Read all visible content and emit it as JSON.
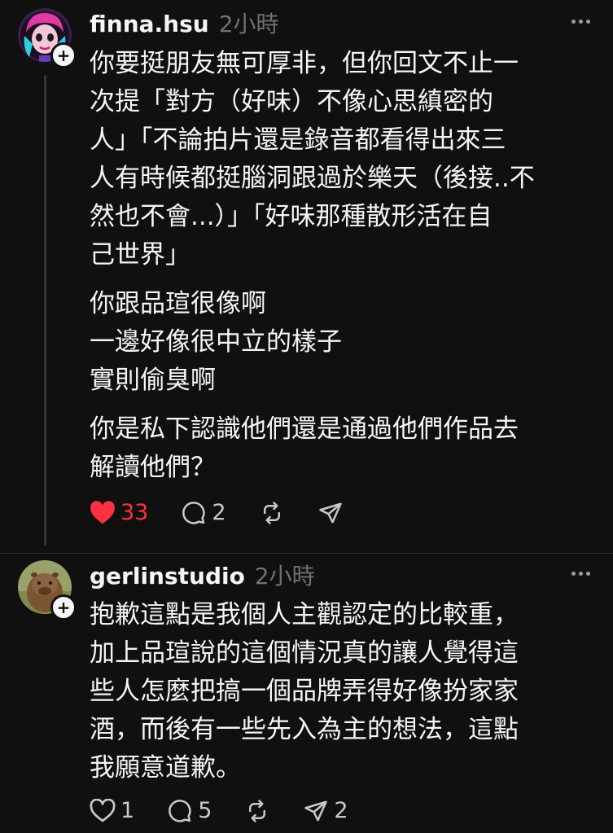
{
  "posts": [
    {
      "username": "finna.hsu",
      "time": "2小時",
      "paragraphs": [
        "你要挺朋友無可厚非，但你回文不止一\n次提「對方（好味）不像心思縝密的\n人」「不論拍片還是錄音都看得出來三\n人有時候都挺腦洞跟過於樂天（後接..不\n然也不會...）」「好味那種散形活在自\n己世界」",
        "你跟品瑄很像啊\n一邊好像很中立的樣子\n實則偷臭啊",
        "你是私下認識他們還是通過他們作品去\n解讀他們？"
      ],
      "likes": "33",
      "liked": true,
      "replies": "2",
      "reposts": "",
      "shares": ""
    },
    {
      "username": "gerlinstudio",
      "time": "2小時",
      "paragraphs": [
        "抱歉這點是我個人主觀認定的比較重，\n加上品瑄說的這個情況真的讓人覺得這\n些人怎麼把搞一個品牌弄得好像扮家家\n酒，而後有一些先入為主的想法，這點\n我願意道歉。"
      ],
      "likes": "1",
      "liked": false,
      "replies": "5",
      "reposts": "",
      "shares": "2"
    }
  ],
  "colors": {
    "background": "#101010",
    "text": "#f3f5f7",
    "muted": "#6f7174",
    "like_active": "#ff3040"
  },
  "icons": {
    "like": "heart-icon",
    "reply": "speech-bubble-icon",
    "repost": "repost-arrows-icon",
    "share": "paper-plane-icon",
    "more": "ellipsis-icon",
    "follow": "plus-icon"
  }
}
